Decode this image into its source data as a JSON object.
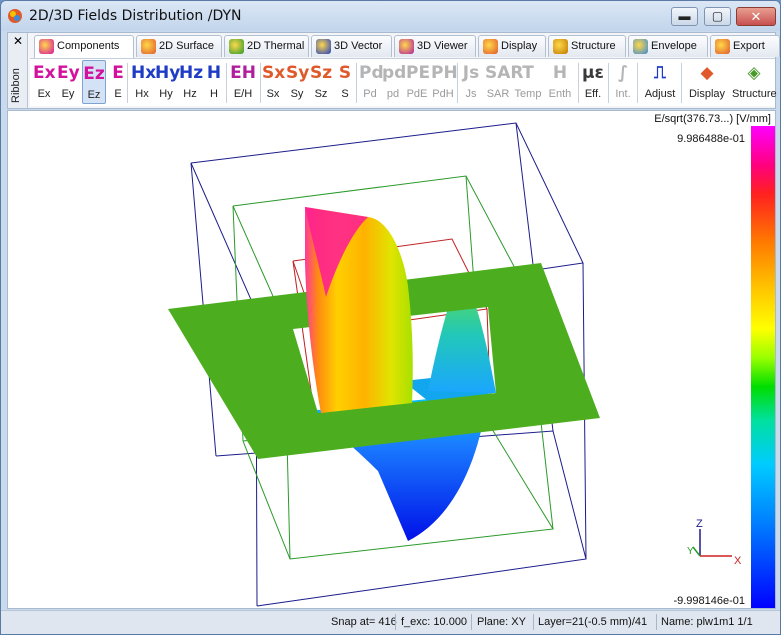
{
  "window": {
    "title": "2D/3D Fields Distribution /DYN",
    "buttons": {
      "minimize": "▬",
      "maximize": "▢",
      "close": "✕"
    }
  },
  "ribbon": {
    "side_label": "Ribbon",
    "close_glyph": "✕",
    "tabs": [
      {
        "label": "Components",
        "icon": "components-icon",
        "active": true
      },
      {
        "label": "2D Surface",
        "icon": "surface-icon"
      },
      {
        "label": "2D Thermal",
        "icon": "thermal-icon"
      },
      {
        "label": "3D Vector",
        "icon": "vector-icon"
      },
      {
        "label": "3D Viewer",
        "icon": "viewer-icon"
      },
      {
        "label": "Display",
        "icon": "display-icon"
      },
      {
        "label": "Structure",
        "icon": "structure-icon"
      },
      {
        "label": "Envelope",
        "icon": "envelope-icon"
      },
      {
        "label": "Export",
        "icon": "export-icon"
      }
    ],
    "buttons": [
      {
        "big": "Ex",
        "label": "Ex",
        "color": "#d4109e"
      },
      {
        "big": "Ey",
        "label": "Ey",
        "color": "#d4109e"
      },
      {
        "big": "Ez",
        "label": "Ez",
        "color": "#d4109e",
        "selected": true
      },
      {
        "big": "E",
        "label": "E",
        "color": "#d4109e"
      },
      {
        "big": "Hx",
        "label": "Hx",
        "color": "#1f3cc4"
      },
      {
        "big": "Hy",
        "label": "Hy",
        "color": "#1f3cc4"
      },
      {
        "big": "Hz",
        "label": "Hz",
        "color": "#1f3cc4"
      },
      {
        "big": "H",
        "label": "H",
        "color": "#1f3cc4"
      },
      {
        "big": "EH",
        "label": "E/H",
        "color": "#b01e9e"
      },
      {
        "big": "Sx",
        "label": "Sx",
        "color": "#e0592a"
      },
      {
        "big": "Sy",
        "label": "Sy",
        "color": "#e0592a"
      },
      {
        "big": "Sz",
        "label": "Sz",
        "color": "#e0592a"
      },
      {
        "big": "S",
        "label": "S",
        "color": "#e0592a"
      },
      {
        "big": "Pd",
        "label": "Pd",
        "disabled": true
      },
      {
        "big": "pd",
        "label": "pd",
        "disabled": true
      },
      {
        "big": "PE",
        "label": "PdE",
        "disabled": true
      },
      {
        "big": "PH",
        "label": "PdH",
        "disabled": true
      },
      {
        "big": "Js",
        "label": "Js",
        "disabled": true
      },
      {
        "big": "SAR",
        "label": "SAR",
        "disabled": true
      },
      {
        "big": "T",
        "label": "Temp",
        "disabled": true
      },
      {
        "big": "H",
        "label": "Enth",
        "disabled": true
      },
      {
        "big": "με",
        "label": "Eff.",
        "color": "#3a3a3a"
      },
      {
        "big": "∫",
        "label": "Int.",
        "disabled": true
      },
      {
        "big": "⎍",
        "label": "Adjust",
        "color": "#1f3cc4"
      },
      {
        "big": "◆",
        "label": "Display",
        "color": "#e0592a"
      },
      {
        "big": "◈",
        "label": "Structure",
        "color": "#4a9a2a"
      }
    ]
  },
  "viewport": {
    "colorbar_title": "E/sqrt(376.73...) [V/mm]",
    "colorbar_max": "9.986488e-01",
    "colorbar_min": "-9.998146e-01",
    "axes": {
      "x": "X",
      "y": "Y",
      "z": "Z"
    }
  },
  "status": {
    "snap": "Snap at= 416",
    "f_exc": "f_exc: 10.000",
    "plane": "Plane: XY",
    "layer": "Layer=21(-0.5 mm)/41",
    "name": "Name: plw1m1 1/1"
  }
}
